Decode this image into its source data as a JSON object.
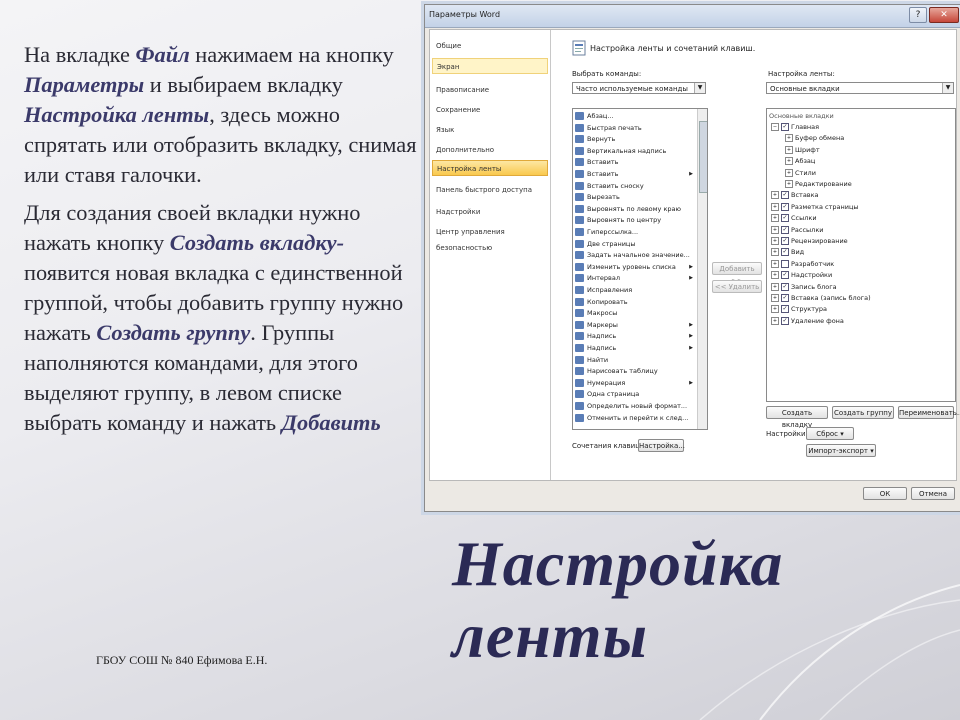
{
  "slide": {
    "paragraph1": [
      {
        "t": "На вкладке ",
        "k": false
      },
      {
        "t": "Файл",
        "k": true
      },
      {
        "t": " нажимаем на кнопку ",
        "k": false
      },
      {
        "t": "Параметры",
        "k": true
      },
      {
        "t": " и выбираем вкладку ",
        "k": false
      },
      {
        "t": "Настройка ленты",
        "k": true
      },
      {
        "t": ", здесь можно спрятать или отобразить вкладку, снимая или ставя галочки.",
        "k": false
      }
    ],
    "paragraph2": [
      {
        "t": "Для создания своей вкладки нужно нажать кнопку ",
        "k": false
      },
      {
        "t": "Создать вкладку-",
        "k": true
      },
      {
        "t": " появится новая вкладка с единственной группой, чтобы добавить группу нужно нажать ",
        "k": false
      },
      {
        "t": "Создать группу",
        "k": true
      },
      {
        "t": ". Группы наполняются командами, для этого выделяют группу, в левом списке выбрать команду и нажать ",
        "k": false
      },
      {
        "t": "Добавить",
        "k": true
      }
    ],
    "footer": "ГБОУ СОШ № 840 Ефимова Е.Н.",
    "title_line1": "Настройка",
    "title_line2": "ленты"
  },
  "dialog": {
    "title": "Параметры Word",
    "help_label": "?",
    "close_label": "✕",
    "nav": [
      "Общие",
      "Экран",
      "Правописание",
      "Сохранение",
      "Язык",
      "Дополнительно",
      "Настройка ленты",
      "Панель быстрого доступа",
      "Надстройки",
      "Центр управления безопасностью"
    ],
    "header": "Настройка ленты и сочетаний клавиш.",
    "choose_commands_label": "Выбрать команды:",
    "choose_commands_value": "Часто используемые команды",
    "customize_ribbon_label": "Настройка ленты:",
    "customize_ribbon_value": "Основные вкладки",
    "commands": [
      {
        "label": "Абзац...",
        "sub": false
      },
      {
        "label": "Быстрая печать",
        "sub": false
      },
      {
        "label": "Вернуть",
        "sub": false
      },
      {
        "label": "Вертикальная надпись",
        "sub": false
      },
      {
        "label": "Вставить",
        "sub": false
      },
      {
        "label": "Вставить",
        "sub": true
      },
      {
        "label": "Вставить сноску",
        "sub": false
      },
      {
        "label": "Вырезать",
        "sub": false
      },
      {
        "label": "Выровнять по левому краю",
        "sub": false
      },
      {
        "label": "Выровнять по центру",
        "sub": false
      },
      {
        "label": "Гиперссылка...",
        "sub": false
      },
      {
        "label": "Две страницы",
        "sub": false
      },
      {
        "label": "Задать начальное значение...",
        "sub": false
      },
      {
        "label": "Изменить уровень списка",
        "sub": true
      },
      {
        "label": "Интервал",
        "sub": true
      },
      {
        "label": "Исправления",
        "sub": false
      },
      {
        "label": "Копировать",
        "sub": false
      },
      {
        "label": "Макросы",
        "sub": false
      },
      {
        "label": "Маркеры",
        "sub": true
      },
      {
        "label": "Надпись",
        "sub": true
      },
      {
        "label": "Надпись",
        "sub": true
      },
      {
        "label": "Найти",
        "sub": false
      },
      {
        "label": "Нарисовать таблицу",
        "sub": false
      },
      {
        "label": "Нумерация",
        "sub": true
      },
      {
        "label": "Одна страница",
        "sub": false
      },
      {
        "label": "Определить новый формат...",
        "sub": false
      },
      {
        "label": "Отменить и перейти к след...",
        "sub": false
      }
    ],
    "add_button": "Добавить >>",
    "remove_button": "<< Удалить",
    "tabs_header": "Основные вкладки",
    "tabs": [
      {
        "label": "Главная",
        "level": 0,
        "expander": "⊟",
        "checked": true
      },
      {
        "label": "Буфер обмена",
        "level": 1,
        "expander": "⊞",
        "checked": null
      },
      {
        "label": "Шрифт",
        "level": 1,
        "expander": "⊞",
        "checked": null
      },
      {
        "label": "Абзац",
        "level": 1,
        "expander": "⊞",
        "checked": null
      },
      {
        "label": "Стили",
        "level": 1,
        "expander": "⊞",
        "checked": null
      },
      {
        "label": "Редактирование",
        "level": 1,
        "expander": "⊞",
        "checked": null
      },
      {
        "label": "Вставка",
        "level": 0,
        "expander": "⊞",
        "checked": true
      },
      {
        "label": "Разметка страницы",
        "level": 0,
        "expander": "⊞",
        "checked": true
      },
      {
        "label": "Ссылки",
        "level": 0,
        "expander": "⊞",
        "checked": true
      },
      {
        "label": "Рассылки",
        "level": 0,
        "expander": "⊞",
        "checked": true
      },
      {
        "label": "Рецензирование",
        "level": 0,
        "expander": "⊞",
        "checked": true
      },
      {
        "label": "Вид",
        "level": 0,
        "expander": "⊞",
        "checked": true
      },
      {
        "label": "Разработчик",
        "level": 0,
        "expander": "⊞",
        "checked": false
      },
      {
        "label": "Надстройки",
        "level": 0,
        "expander": "⊞",
        "checked": true
      },
      {
        "label": "Запись блога",
        "level": 0,
        "expander": "⊞",
        "checked": true
      },
      {
        "label": "Вставка (запись блога)",
        "level": 0,
        "expander": "⊞",
        "checked": true
      },
      {
        "label": "Структура",
        "level": 0,
        "expander": "⊞",
        "checked": true
      },
      {
        "label": "Удаление фона",
        "level": 0,
        "expander": "⊞",
        "checked": true
      }
    ],
    "new_tab_button": "Создать вкладку",
    "new_group_button": "Создать группу",
    "rename_button": "Переименовать...",
    "customizations_label": "Настройки:",
    "reset_button": "Сброс ▾",
    "import_export_button": "Импорт-экспорт ▾",
    "shortcuts_label": "Сочетания клавиш:",
    "shortcuts_button": "Настройка...",
    "ok_button": "ОК",
    "cancel_button": "Отмена"
  }
}
